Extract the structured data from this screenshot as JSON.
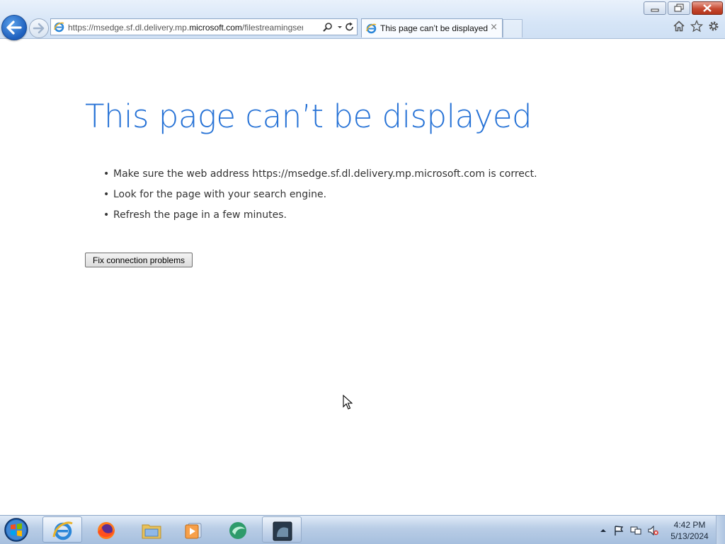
{
  "browser": {
    "url_prefix": "https://msedge.sf.dl.delivery.mp.",
    "url_domain": "microsoft.com",
    "url_suffix": "/filestreamingservic",
    "tab_title": "This page can’t be displayed",
    "tab_close": "×",
    "icons": [
      "back-arrow",
      "forward-arrow",
      "ie-logo",
      "search",
      "dropdown",
      "refresh",
      "home",
      "favorites-star",
      "tools-gear"
    ]
  },
  "page": {
    "heading": "This page can’t be displayed",
    "bullet": "•",
    "tips": [
      "Make sure the web address https://msedge.sf.dl.delivery.mp.microsoft.com is correct.",
      "Look for the page with your search engine.",
      "Refresh the page in a few minutes."
    ],
    "fix_button": "Fix connection problems"
  },
  "taskbar": {
    "pinned": [
      "internet-explorer",
      "firefox",
      "file-explorer",
      "media-player",
      "app-green-circle",
      "app-dark-window"
    ],
    "clock_time": "4:42 PM",
    "clock_date": "5/13/2024",
    "tray_icons": [
      "show-hidden-arrow",
      "action-center-flag",
      "network",
      "volume-muted"
    ]
  },
  "colors": {
    "heading": "#2672d6",
    "close_button": "#c74a32",
    "chrome": "#d6e5f7",
    "taskbar": "#b9cde6"
  }
}
